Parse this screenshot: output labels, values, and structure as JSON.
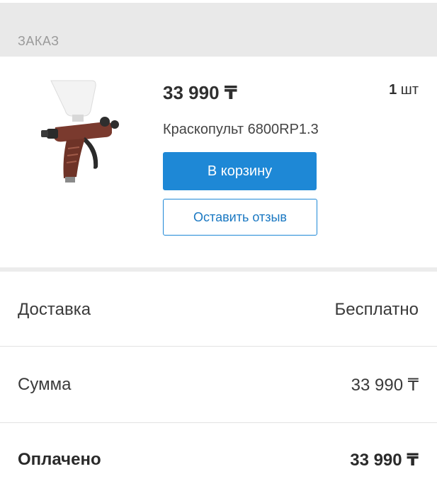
{
  "section": {
    "title": "ЗАКАЗ"
  },
  "product": {
    "image_icon": "spray-gun-image",
    "price": "33 990 ₸",
    "qty_number": "1",
    "qty_unit": "шт",
    "name": "Краскопульт 6800RP1.3",
    "cart_button": "В корзину",
    "review_button": "Оставить отзыв"
  },
  "summary": {
    "delivery_label": "Доставка",
    "delivery_value": "Бесплатно",
    "sum_label": "Сумма",
    "sum_value": "33 990 ₸",
    "paid_label": "Оплачено",
    "paid_value": "33 990 ₸"
  },
  "colors": {
    "accent": "#1e88d6",
    "header_bg": "#e9e9e9",
    "gun_body": "#7a3a2e"
  }
}
